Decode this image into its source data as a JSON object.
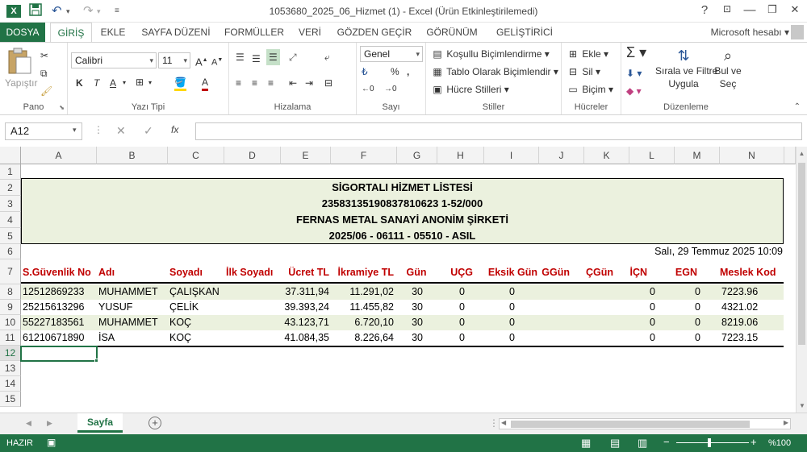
{
  "window": {
    "title": "1053680_2025_06_Hizmet (1) - Excel (Ürün Etkinleştirilemedi)",
    "help": "?",
    "controls": [
      "—",
      "❐",
      "✕"
    ]
  },
  "ribbon_tabs": [
    "DOSYA",
    "GİRİŞ",
    "EKLE",
    "SAYFA DÜZENİ",
    "FORMÜLLER",
    "VERİ",
    "GÖZDEN GEÇİR",
    "GÖRÜNÜM",
    "GELİŞTİRİCİ"
  ],
  "account": "Microsoft hesabı",
  "ribbon": {
    "pano": {
      "label": "Pano",
      "paste": "Yapıştır"
    },
    "font": {
      "label": "Yazı Tipi",
      "name": "Calibri",
      "size": "11",
      "bold": "K",
      "italic": "T",
      "underline": "A"
    },
    "align": {
      "label": "Hizalama"
    },
    "number": {
      "label": "Sayı",
      "format": "Genel"
    },
    "styles": {
      "label": "Stiller",
      "cond": "Koşullu Biçimlendirme",
      "table": "Tablo Olarak Biçimlendir",
      "cell": "Hücre Stilleri"
    },
    "cells": {
      "label": "Hücreler",
      "insert": "Ekle",
      "delete": "Sil",
      "format": "Biçim"
    },
    "editing": {
      "label": "Düzenleme",
      "sort": "Sırala ve Filtre",
      "sort2": "Uygula",
      "find": "Bul ve",
      "find2": "Seç"
    }
  },
  "formula": {
    "namebox": "A12",
    "fx": "fx"
  },
  "columns": [
    "A",
    "B",
    "C",
    "D",
    "E",
    "F",
    "G",
    "H",
    "I",
    "J",
    "K",
    "L",
    "M",
    "N"
  ],
  "rows": [
    "1",
    "2",
    "3",
    "4",
    "5",
    "6",
    "7",
    "8",
    "9",
    "10",
    "11",
    "12",
    "13",
    "14",
    "15"
  ],
  "report": {
    "title": "SİGORTALI HİZMET LİSTESİ",
    "code": "23583135190837810623 1-52/000",
    "company": "FERNAS METAL SANAYİ ANONİM ŞİRKETİ",
    "period": "2025/06 - 06111 - 05510 - ASIL",
    "date": "Salı, 29 Temmuz 2025 10:09"
  },
  "table": {
    "headers": [
      "S.Güvenlik No",
      "Adı",
      "Soyadı",
      "İlk Soyadı",
      "Ücret TL",
      "İkramiye TL",
      "Gün",
      "UÇG",
      "Eksik Gün",
      "GGün",
      "ÇGün",
      "İÇN",
      "EGN",
      "Meslek Kod"
    ],
    "rows": [
      [
        "12512869233",
        "MUHAMMET",
        "ÇALIŞKAN",
        "",
        "37.311,94",
        "11.291,02",
        "30",
        "0",
        "0",
        "",
        "",
        "0",
        "0",
        "7223.96"
      ],
      [
        "25215613296",
        "YUSUF",
        "ÇELİK",
        "",
        "39.393,24",
        "11.455,82",
        "30",
        "0",
        "0",
        "",
        "",
        "0",
        "0",
        "4321.02"
      ],
      [
        "55227183561",
        "MUHAMMET",
        "KOÇ",
        "",
        "43.123,71",
        "6.720,10",
        "30",
        "0",
        "0",
        "",
        "",
        "0",
        "0",
        "8219.06"
      ],
      [
        "61210671890",
        "İSA",
        "KOÇ",
        "",
        "41.084,35",
        "8.226,64",
        "30",
        "0",
        "0",
        "",
        "",
        "0",
        "0",
        "7223.15"
      ]
    ]
  },
  "sheet": {
    "tab": "Sayfa"
  },
  "status": {
    "ready": "HAZIR",
    "zoom": "%100",
    "zoom_minus": "−",
    "zoom_plus": "+"
  }
}
